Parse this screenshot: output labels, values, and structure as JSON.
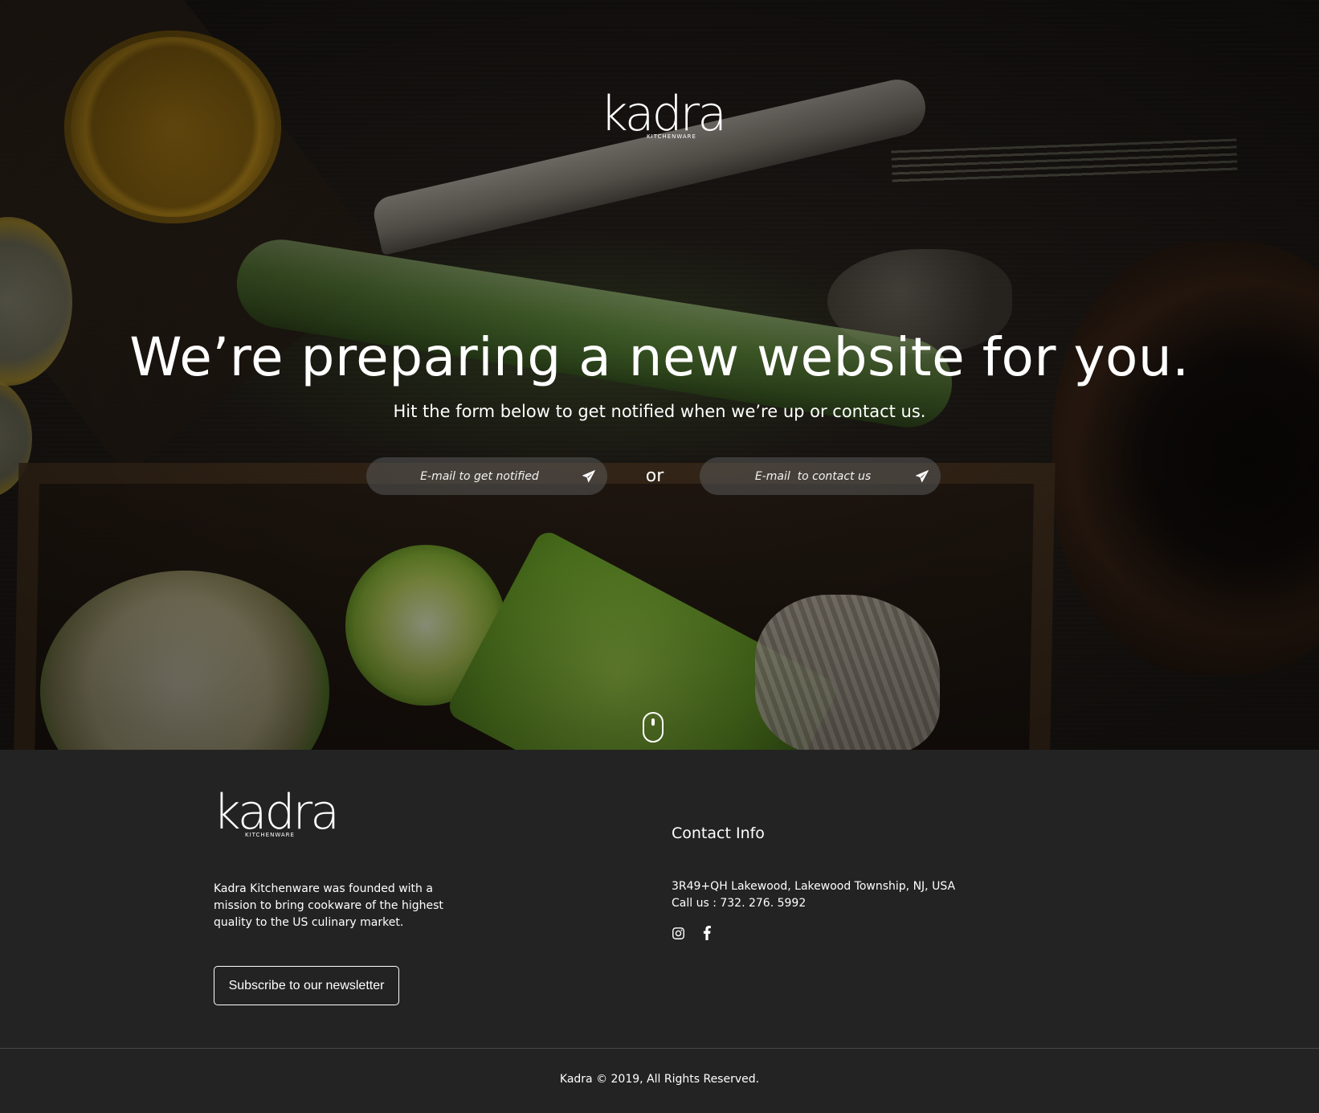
{
  "brand": {
    "name": "kadra",
    "tagline": "KITCHENWARE"
  },
  "hero": {
    "headline": "We’re preparing a new website for you.",
    "subheadline": "Hit the form below to get notified when we’re up or contact us.",
    "notify_placeholder": "E-mail to get notified",
    "separator": "or",
    "contact_placeholder": "E-mail  to contact us"
  },
  "footer": {
    "about": "Kadra Kitchenware was founded with a mission to bring cookware of the highest quality to the US culinary market.",
    "subscribe_label": "Subscribe to our newsletter",
    "contact_title": "Contact Info",
    "address": "3R49+QH Lakewood, Lakewood Township, NJ, USA",
    "phone": "Call us : 732. 276. 5992",
    "copyright": "Kadra © 2019, All Rights Reserved."
  },
  "icons": {
    "send": "paper-plane-icon",
    "instagram": "instagram-icon",
    "facebook": "facebook-icon",
    "scroll": "mouse-scroll-icon"
  }
}
